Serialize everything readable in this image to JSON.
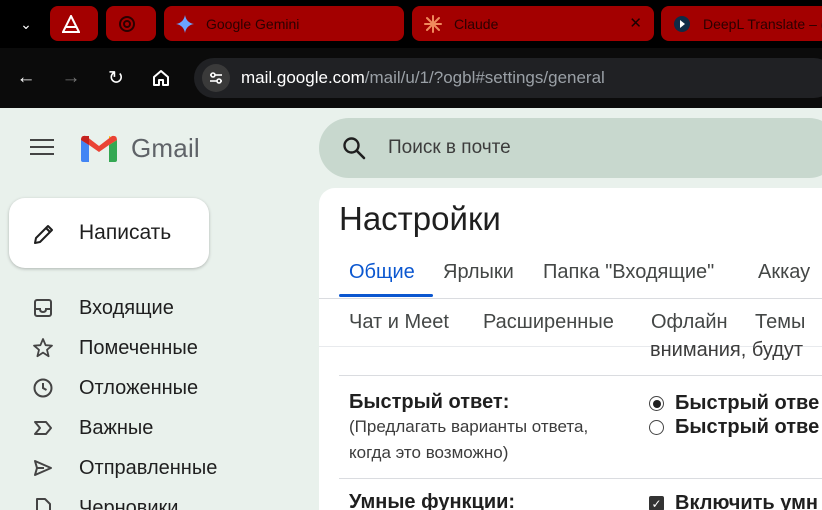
{
  "browser": {
    "tabs": [
      {
        "label": "",
        "icon": "triangle-logo-icon"
      },
      {
        "label": "",
        "icon": "openai-logo-icon"
      },
      {
        "label": "Google Gemini",
        "icon": "gemini-sparkle-icon"
      },
      {
        "label": "Claude",
        "icon": "claude-asterisk-icon"
      },
      {
        "label": "DeepL Translate – (",
        "icon": "deepl-logo-icon"
      }
    ],
    "url_host": "mail.google.com",
    "url_path": "/mail/u/1/?ogbl#settings/general"
  },
  "gmail": {
    "logo_text": "Gmail",
    "compose_label": "Написать",
    "search_placeholder": "Поиск в почте",
    "nav": [
      {
        "label": "Входящие",
        "icon": "inbox-icon"
      },
      {
        "label": "Помеченные",
        "icon": "star-icon"
      },
      {
        "label": "Отложенные",
        "icon": "clock-icon"
      },
      {
        "label": "Важные",
        "icon": "important-icon"
      },
      {
        "label": "Отправленные",
        "icon": "send-icon"
      },
      {
        "label": "Черновики",
        "icon": "draft-icon"
      }
    ]
  },
  "settings": {
    "title": "Настройки",
    "tabs_row1": [
      "Общие",
      "Ярлыки",
      "Папка \"Входящие\"",
      "Аккау"
    ],
    "tabs_row2": [
      "Чат и Meet",
      "Расширенные",
      "Офлайн",
      "Темы"
    ],
    "clipped_text": "внимания, будут",
    "quick_reply": {
      "name": "Быстрый ответ:",
      "desc": "(Предлагать варианты ответа, когда это возможно)",
      "options": [
        "Быстрый отве",
        "Быстрый отве"
      ]
    },
    "smart": {
      "name": "Умные функции:",
      "option": "Включить умн"
    }
  },
  "colors": {
    "tab_bg": "#a30000",
    "accent": "#0b57d0",
    "page_bg": "#e9f1ec"
  }
}
